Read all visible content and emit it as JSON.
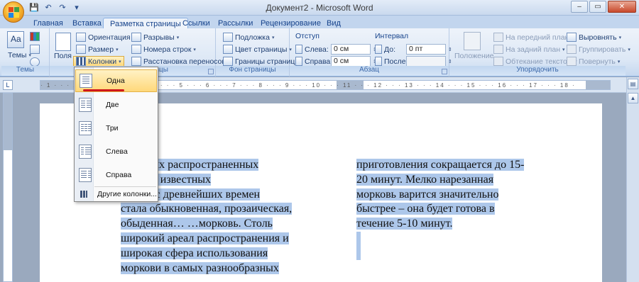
{
  "window": {
    "title": "Документ2 - Microsoft Word",
    "controls": {
      "minimize": "–",
      "maximize": "▭",
      "close": "✕"
    }
  },
  "quick_access": {
    "save": "💾",
    "undo": "↶",
    "redo": "↷",
    "customize": "▾"
  },
  "tabs": [
    {
      "label": "Главная"
    },
    {
      "label": "Вставка"
    },
    {
      "label": "Разметка страницы"
    },
    {
      "label": "Ссылки"
    },
    {
      "label": "Рассылки"
    },
    {
      "label": "Рецензирование"
    },
    {
      "label": "Вид"
    }
  ],
  "ribbon": {
    "themes": {
      "big_label": "Темы",
      "group_label": "Темы"
    },
    "page_setup": {
      "fields_label": "Поля",
      "orientation": "Ориентация",
      "size": "Размер",
      "columns": "Колонки",
      "breaks": "Разрывы",
      "line_numbers": "Номера строк",
      "hyphenation": "Расстановка переносов",
      "group_label": "Параметры страницы"
    },
    "page_background": {
      "watermark": "Подложка",
      "page_color": "Цвет страницы",
      "page_borders": "Границы страниц",
      "group_label": "Фон страницы"
    },
    "paragraph": {
      "indent_header": "Отступ",
      "left_label": "Слева:",
      "left_value": "0 см",
      "right_label": "Справа:",
      "right_value": "0 см",
      "spacing_header": "Интервал",
      "before_label": "До:",
      "before_value": "0 пт",
      "after_label": "После:",
      "after_value": "",
      "group_label": "Абзац"
    },
    "arrange": {
      "position": "Положение",
      "bring_front": "На передний план",
      "send_back": "На задний план",
      "text_wrap": "Обтекание текстом",
      "align": "Выровнять",
      "group": "Группировать",
      "rotate": "Повернуть",
      "group_label": "Упорядочить"
    }
  },
  "columns_menu": {
    "items": [
      {
        "label": "Одна"
      },
      {
        "label": "Две"
      },
      {
        "label": "Три"
      },
      {
        "label": "Слева"
      },
      {
        "label": "Справа"
      }
    ],
    "more": "Другие колонки..."
  },
  "document": {
    "col1_lines": [
      "из самых распространенных",
      "плодов, известных",
      "честву с древнейших времен",
      "стала обыкновенная, прозаическая,",
      "обыденная… …морковь. Столь",
      "широкий ареал распространения и",
      "широкая сфера использования",
      "моркови в самых разнообразных"
    ],
    "col2_lines": [
      "приготовления сокращается до 15-",
      "20 минут. Мелко нарезанная",
      "морковь варится значительно",
      "быстрее – она будет готова в",
      "течение 5-10 минут."
    ]
  }
}
